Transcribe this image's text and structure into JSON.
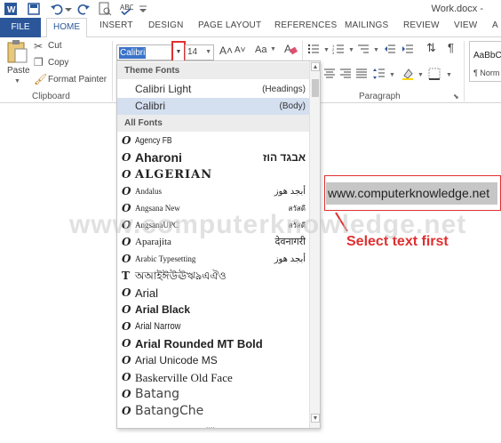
{
  "title": {
    "document": "Work.docx - "
  },
  "tabs": [
    "FILE",
    "HOME",
    "INSERT",
    "DESIGN",
    "PAGE LAYOUT",
    "REFERENCES",
    "MAILINGS",
    "REVIEW",
    "VIEW",
    "A"
  ],
  "clipboard": {
    "paste": "Paste",
    "cut": "Cut",
    "copy": "Copy",
    "format_painter": "Format Painter",
    "group_label": "Clipboard"
  },
  "font": {
    "current_font": "Calibri",
    "current_size": "14",
    "grow": "A˄",
    "shrink": "A˅",
    "case": "Aa",
    "clear": "A"
  },
  "paragraph": {
    "group_label": "Paragraph"
  },
  "styles": {
    "preview": "AaBbC",
    "normal": "¶ Norm"
  },
  "dropdown": {
    "theme_header": "Theme Fonts",
    "all_header": "All Fonts",
    "theme_fonts": [
      {
        "name": "Calibri Light",
        "tag": "(Headings)"
      },
      {
        "name": "Calibri",
        "tag": "(Body)"
      }
    ],
    "all_fonts": [
      {
        "name": "Agency FB",
        "sample": ""
      },
      {
        "name": "Aharoni",
        "sample": "אבגד הוז"
      },
      {
        "name": "ALGERIAN",
        "sample": ""
      },
      {
        "name": "Andalus",
        "sample": "أبجد هوز"
      },
      {
        "name": "Angsana New",
        "sample": "สวัสดี"
      },
      {
        "name": "AngsanaUPC",
        "sample": "สวัสดี"
      },
      {
        "name": "Aparajita",
        "sample": "देवनागरी"
      },
      {
        "name": "Arabic Typesetting",
        "sample": "أبجد هوز"
      },
      {
        "name": "অআইঈউঊঋঌএঐও",
        "sample": ""
      },
      {
        "name": "Arial",
        "sample": ""
      },
      {
        "name": "Arial Black",
        "sample": ""
      },
      {
        "name": "Arial Narrow",
        "sample": ""
      },
      {
        "name": "Arial Rounded MT Bold",
        "sample": ""
      },
      {
        "name": "Arial Unicode MS",
        "sample": ""
      },
      {
        "name": "Baskerville Old Face",
        "sample": ""
      },
      {
        "name": "Batang",
        "sample": ""
      },
      {
        "name": "BatangChe",
        "sample": ""
      }
    ],
    "grip": "....",
    "scroll_up": "▲",
    "scroll_down": "▼"
  },
  "document": {
    "selected_text": "www.computerknowledge.net",
    "annotation": "Select text first",
    "watermark": "www.computerknowledge.net"
  },
  "colors": {
    "file_tab": "#2b579a",
    "annotation_red": "#e03030",
    "selection_gray": "#c6c6c6"
  }
}
